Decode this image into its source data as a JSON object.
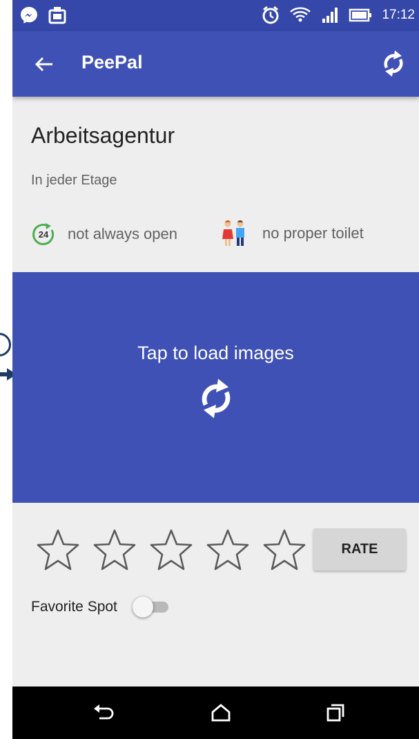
{
  "status_bar": {
    "time": "17:12",
    "icons": [
      "messenger-icon",
      "photo-notification-icon",
      "alarm-icon",
      "wifi-icon",
      "signal-icon",
      "battery-icon"
    ]
  },
  "app_bar": {
    "title": "PeePal",
    "back_icon": "arrow-left-icon",
    "refresh_icon": "refresh-icon"
  },
  "place": {
    "name": "Arbeitsagentur",
    "description": "In jeder Etage",
    "features": [
      {
        "icon": "24-hours-icon",
        "label": "not always open"
      },
      {
        "icon": "toilet-people-icon",
        "label": "no proper toilet"
      }
    ]
  },
  "image_panel": {
    "label": "Tap to load images",
    "icon": "refresh-icon"
  },
  "rating": {
    "max_stars": 5,
    "current_rating": 0,
    "button_label": "RATE"
  },
  "favorite": {
    "label": "Favorite Spot",
    "enabled": false
  },
  "navigation_bar": {
    "icons": [
      "nav-back-icon",
      "nav-home-icon",
      "nav-recents-icon"
    ]
  },
  "colors": {
    "primary": "#3f51b5",
    "primary_dark": "#3547a8",
    "background": "#eeeeee",
    "feature_green": "#4caf50"
  }
}
